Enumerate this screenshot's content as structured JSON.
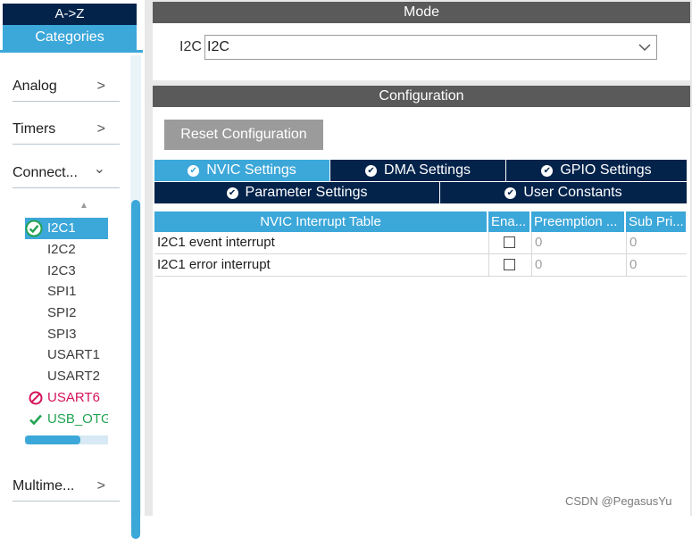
{
  "left_panel": {
    "sort_tab_label": "A->Z",
    "categories_tab_label": "Categories",
    "categories": [
      {
        "label": "Analog",
        "chevron": ">"
      },
      {
        "label": "Timers",
        "chevron": ">"
      },
      {
        "label": "Connect...",
        "chevron": "⌄"
      },
      {
        "label": "Multime...",
        "chevron": ">"
      }
    ],
    "scroll_up_glyph": "▲",
    "peripherals": [
      {
        "label": "I2C1",
        "status": "enabled-selected",
        "status_icon": "check-circle-icon"
      },
      {
        "label": "I2C2",
        "status": "none"
      },
      {
        "label": "I2C3",
        "status": "none"
      },
      {
        "label": "SPI1",
        "status": "none"
      },
      {
        "label": "SPI2",
        "status": "none"
      },
      {
        "label": "SPI3",
        "status": "none"
      },
      {
        "label": "USART1",
        "status": "none"
      },
      {
        "label": "USART2",
        "status": "none"
      },
      {
        "label": "USART6",
        "status": "conflict",
        "status_icon": "prohibited-icon"
      },
      {
        "label": "USB_OTG",
        "status": "configured",
        "status_icon": "checkmark-icon"
      }
    ]
  },
  "mode": {
    "header": "Mode",
    "field_label": "I2C",
    "select_value": "I2C"
  },
  "configuration": {
    "header": "Configuration",
    "reset_button": "Reset Configuration",
    "tabs_row1": [
      "NVIC Settings",
      "DMA Settings",
      "GPIO Settings"
    ],
    "tabs_row2": [
      "Parameter Settings",
      "User Constants"
    ],
    "active_tab": "NVIC Settings",
    "table": {
      "columns": [
        "NVIC Interrupt Table",
        "Ena...",
        "Preemption ...",
        "Sub Pri..."
      ],
      "rows": [
        {
          "name": "I2C1 event interrupt",
          "enabled": false,
          "preemption": "0",
          "sub_priority": "0"
        },
        {
          "name": "I2C1 error interrupt",
          "enabled": false,
          "preemption": "0",
          "sub_priority": "0"
        }
      ]
    }
  },
  "watermark": "CSDN @PegasusYu",
  "colors": {
    "navy": "#03234b",
    "accent_blue": "#3ca7d9",
    "header_gray": "#5a5a5a",
    "button_gray": "#9b9b9b",
    "conflict_pink": "#d4145a",
    "ok_green": "#22a352"
  }
}
